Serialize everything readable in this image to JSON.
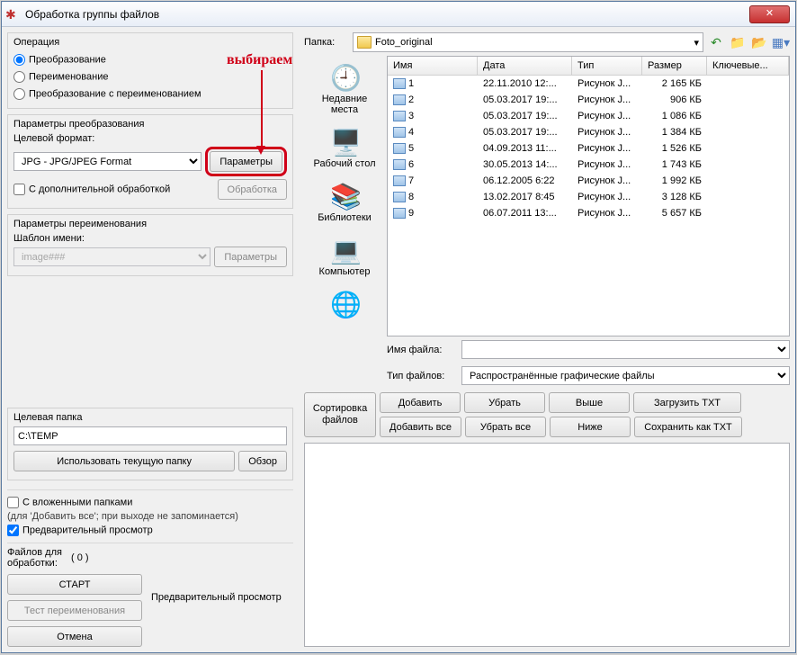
{
  "window": {
    "title": "Обработка группы файлов"
  },
  "annotation": "выбираем",
  "operation": {
    "title": "Операция",
    "opt_convert": "Преобразование",
    "opt_rename": "Переименование",
    "opt_both": "Преобразование с переименованием"
  },
  "convert": {
    "title": "Параметры преобразования",
    "target_format_label": "Целевой формат:",
    "format_value": "JPG - JPG/JPEG Format",
    "params_btn": "Параметры",
    "extra_processing": "С дополнительной обработкой",
    "processing_btn": "Обработка"
  },
  "rename": {
    "title": "Параметры переименования",
    "template_label": "Шаблон имени:",
    "template_value": "image###",
    "params_btn": "Параметры"
  },
  "target_folder": {
    "title": "Целевая папка",
    "path": "C:\\TEMP",
    "use_current": "Использовать текущую папку",
    "browse": "Обзор"
  },
  "options": {
    "subfolders": "С вложенными папками",
    "subfolders_hint": "(для 'Добавить все'; при выходе не запоминается)",
    "preview": "Предварительный просмотр"
  },
  "process": {
    "files_label": "Файлов для\nобработки:",
    "count": "( 0 )",
    "start": "СТАРТ",
    "test_rename": "Тест переименования",
    "cancel": "Отмена",
    "preview_label": "Предварительный просмотр"
  },
  "browser": {
    "folder_label": "Папка:",
    "folder_value": "Foto_original",
    "places": {
      "recent": "Недавние\nместа",
      "desktop": "Рабочий стол",
      "libraries": "Библиотеки",
      "computer": "Компьютер",
      "network": ""
    },
    "columns": {
      "name": "Имя",
      "date": "Дата",
      "type": "Тип",
      "size": "Размер",
      "keys": "Ключевые..."
    },
    "files": [
      {
        "name": "1",
        "date": "22.11.2010 12:...",
        "type": "Рисунок J...",
        "size": "2 165 КБ"
      },
      {
        "name": "2",
        "date": "05.03.2017 19:...",
        "type": "Рисунок J...",
        "size": "906 КБ"
      },
      {
        "name": "3",
        "date": "05.03.2017 19:...",
        "type": "Рисунок J...",
        "size": "1 086 КБ"
      },
      {
        "name": "4",
        "date": "05.03.2017 19:...",
        "type": "Рисунок J...",
        "size": "1 384 КБ"
      },
      {
        "name": "5",
        "date": "04.09.2013 11:...",
        "type": "Рисунок J...",
        "size": "1 526 КБ"
      },
      {
        "name": "6",
        "date": "30.05.2013 14:...",
        "type": "Рисунок J...",
        "size": "1 743 КБ"
      },
      {
        "name": "7",
        "date": "06.12.2005 6:22",
        "type": "Рисунок J...",
        "size": "1 992 КБ"
      },
      {
        "name": "8",
        "date": "13.02.2017 8:45",
        "type": "Рисунок J...",
        "size": "3 128 КБ"
      },
      {
        "name": "9",
        "date": "06.07.2011 13:...",
        "type": "Рисунок J...",
        "size": "5 657 КБ"
      }
    ],
    "filename_label": "Имя файла:",
    "filename_value": "",
    "filetype_label": "Тип файлов:",
    "filetype_value": "Распространённые графические файлы"
  },
  "actions": {
    "sort": "Сортировка\nфайлов",
    "add": "Добавить",
    "remove": "Убрать",
    "up": "Выше",
    "load_txt": "Загрузить TXT",
    "add_all": "Добавить все",
    "remove_all": "Убрать все",
    "down": "Ниже",
    "save_txt": "Сохранить как TXT"
  }
}
